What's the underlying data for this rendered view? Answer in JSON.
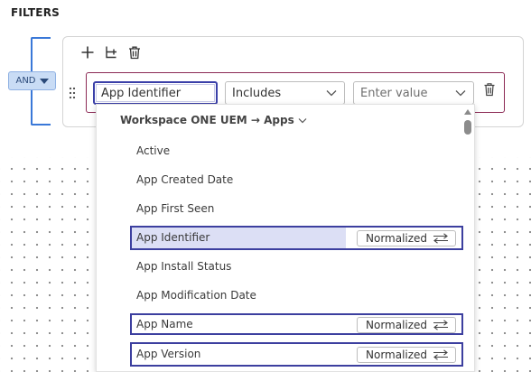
{
  "filters": {
    "title": "FILTERS",
    "logic_operator": "AND"
  },
  "rule": {
    "attribute_value": "App Identifier",
    "operator_value": "Includes",
    "value_placeholder": "Enter value"
  },
  "dropdown": {
    "group_label": "Workspace ONE UEM → Apps",
    "options": [
      {
        "label": "Active",
        "badge": null
      },
      {
        "label": "App Created Date",
        "badge": null
      },
      {
        "label": "App First Seen",
        "badge": null
      },
      {
        "label": "App Identifier",
        "badge": "Normalized",
        "highlighted": true
      },
      {
        "label": "App Install Status",
        "badge": null
      },
      {
        "label": "App Modification Date",
        "badge": null
      },
      {
        "label": "App Name",
        "badge": "Normalized"
      },
      {
        "label": "App Version",
        "badge": "Normalized"
      }
    ]
  },
  "icons": {
    "add": "plus-icon",
    "add_nested": "nested-rule-icon",
    "delete_group": "trash-icon",
    "drag": "drag-handle-icon",
    "delete_rule": "trash-icon",
    "normalized": "swap-arrows-icon"
  },
  "colors": {
    "bracket": "#3a78d8",
    "and_button_bg": "#c9dcf5",
    "rule_border": "#8c2a55",
    "focus_border": "#3a3fa8",
    "highlight_row": "#dcdff5",
    "outline_box": "#3c3f9f"
  }
}
